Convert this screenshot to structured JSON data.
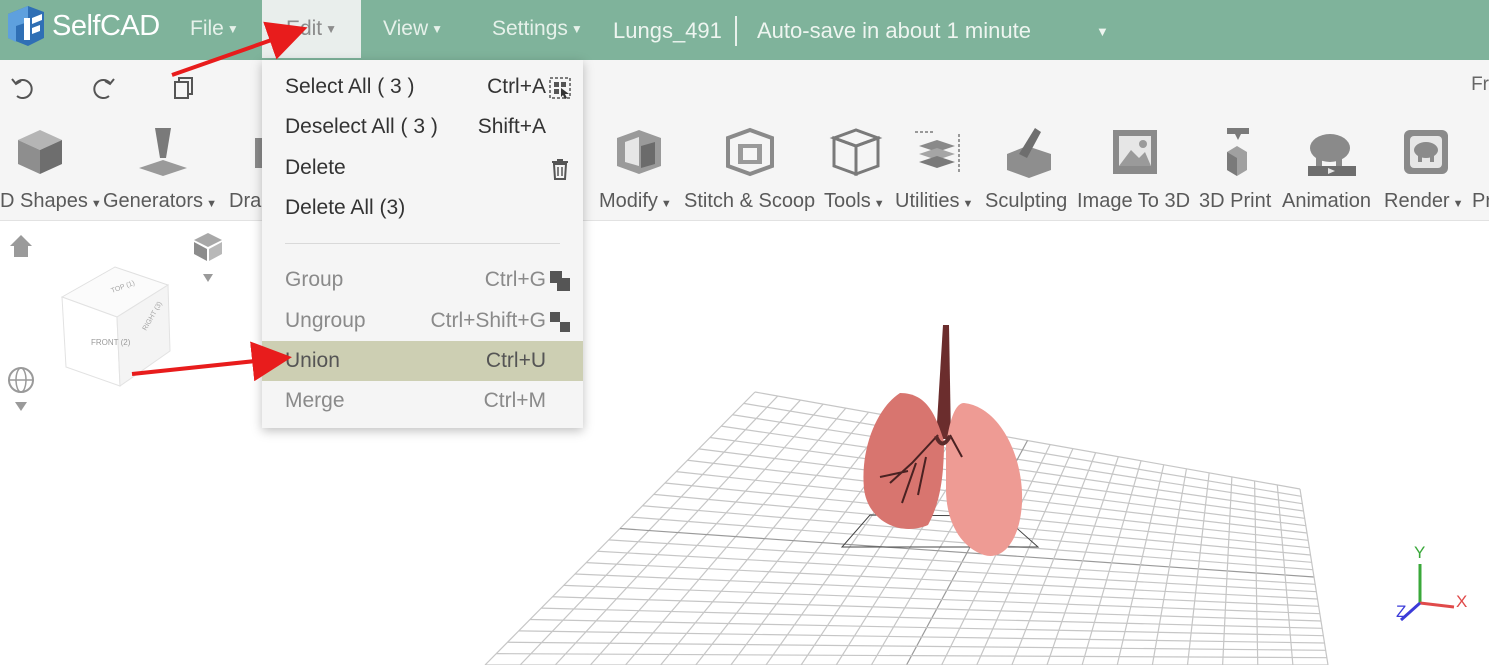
{
  "app": {
    "name": "SelfCAD"
  },
  "menubar": {
    "items": [
      {
        "label": "File"
      },
      {
        "label": "Edit"
      },
      {
        "label": "View"
      },
      {
        "label": "Settings"
      }
    ],
    "filename": "Lungs_491",
    "autosave": "Auto-save in about 1 minute"
  },
  "toolbar": {
    "right_text": "Fr"
  },
  "ribbon": {
    "items": [
      {
        "label": "D Shapes",
        "caret": true
      },
      {
        "label": "Generators",
        "caret": true
      },
      {
        "label": "Dra",
        "caret": false
      },
      {
        "label": "Modify",
        "caret": true
      },
      {
        "label": "Stitch & Scoop",
        "caret": false
      },
      {
        "label": "Tools",
        "caret": true
      },
      {
        "label": "Utilities",
        "caret": true
      },
      {
        "label": "Sculpting",
        "caret": false
      },
      {
        "label": "Image To 3D",
        "caret": false
      },
      {
        "label": "3D Print",
        "caret": false
      },
      {
        "label": "Animation",
        "caret": false
      },
      {
        "label": "Render",
        "caret": true
      },
      {
        "label": "Pr",
        "caret": false
      }
    ]
  },
  "edit_menu": {
    "items": [
      {
        "label": "Select All   ( 3 )",
        "shortcut": "Ctrl+A",
        "state": "enabled",
        "icon": "select-all-icon"
      },
      {
        "label": "Deselect All   ( 3 )",
        "shortcut": "Shift+A",
        "state": "enabled",
        "icon": ""
      },
      {
        "label": "Delete",
        "shortcut": "",
        "state": "enabled",
        "icon": "trash-icon"
      },
      {
        "label": "Delete All (3)",
        "shortcut": "",
        "state": "enabled",
        "icon": ""
      },
      {
        "label": "Group",
        "shortcut": "Ctrl+G",
        "state": "disabled",
        "icon": "group-icon"
      },
      {
        "label": "Ungroup",
        "shortcut": "Ctrl+Shift+G",
        "state": "disabled",
        "icon": "ungroup-icon"
      },
      {
        "label": "Union",
        "shortcut": "Ctrl+U",
        "state": "highlighted",
        "icon": ""
      },
      {
        "label": "Merge",
        "shortcut": "Ctrl+M",
        "state": "disabled",
        "icon": ""
      }
    ]
  },
  "viewcube": {
    "top": "TOP (1)",
    "front": "FRONT (2)",
    "right": "RIGHT (3)"
  },
  "axes": {
    "x": "X",
    "y": "Y",
    "z": "Z"
  },
  "colors": {
    "header": "#7fb39b",
    "highlight": "#cdcfb3",
    "arrow": "#e81c1c",
    "lung": "#e8918a",
    "trachea": "#6b2d2d"
  }
}
